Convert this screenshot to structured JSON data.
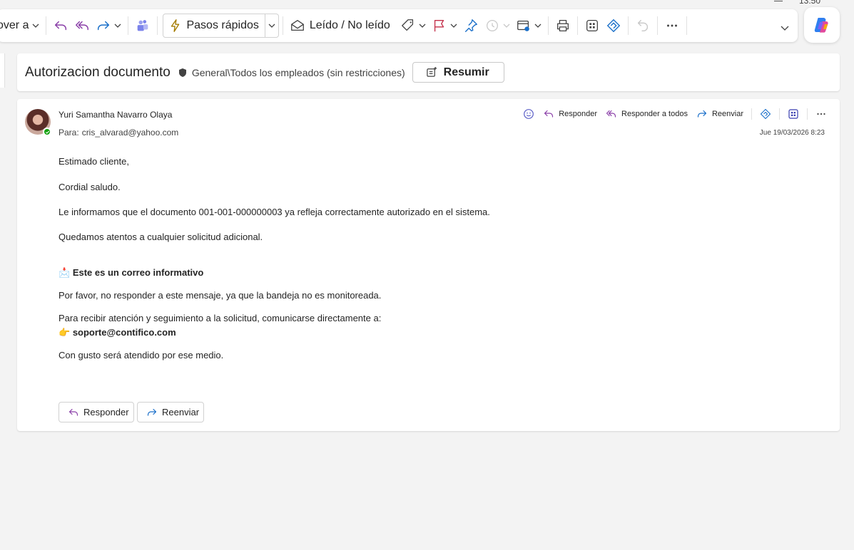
{
  "clock": {
    "time": "13:50"
  },
  "ribbon": {
    "move_label": "over a",
    "quick_steps_label": "Pasos rápidos",
    "read_unread_label": "Leído / No leído"
  },
  "subject_bar": {
    "subject": "Autorizacion documento",
    "sensitivity_label": "General\\Todos los empleados (sin restricciones)",
    "summarize_label": "Resumir"
  },
  "message": {
    "sender": "Yuri Samantha Navarro Olaya",
    "to_label": "Para:",
    "to_address": "cris_alvarad@yahoo.com",
    "date": "Jue 19/03/2026 8:23",
    "actions": {
      "reply": "Responder",
      "reply_all": "Responder a todos",
      "forward": "Reenviar"
    },
    "body": {
      "greeting": "Estimado cliente,",
      "salutation": "Cordial saludo.",
      "info": "Le informamos que el documento 001-001-000000003 ya refleja correctamente autorizado en el sistema.",
      "attentive": "Quedamos atentos a cualquier solicitud adicional.",
      "notice_emoji": "📩",
      "notice_title": "Este es un correo informativo",
      "no_reply": "Por favor, no responder a este mensaje, ya que la bandeja no es monitoreada.",
      "contact_intro": "Para recibir atención y seguimiento a la solicitud, comunicarse directamente a:",
      "contact_emoji": "👉",
      "contact_email": "soporte@contifico.com",
      "closing": "Con gusto será atendido por ese medio."
    },
    "footer": {
      "reply": "Responder",
      "forward": "Reenviar"
    }
  },
  "colors": {
    "reply_icon": "#8a3fa8",
    "forward_icon": "#1a6fc9",
    "flag": "#c4314b",
    "quick_steps_bolt": "#a57c00",
    "accent": "#0f6cbd"
  }
}
